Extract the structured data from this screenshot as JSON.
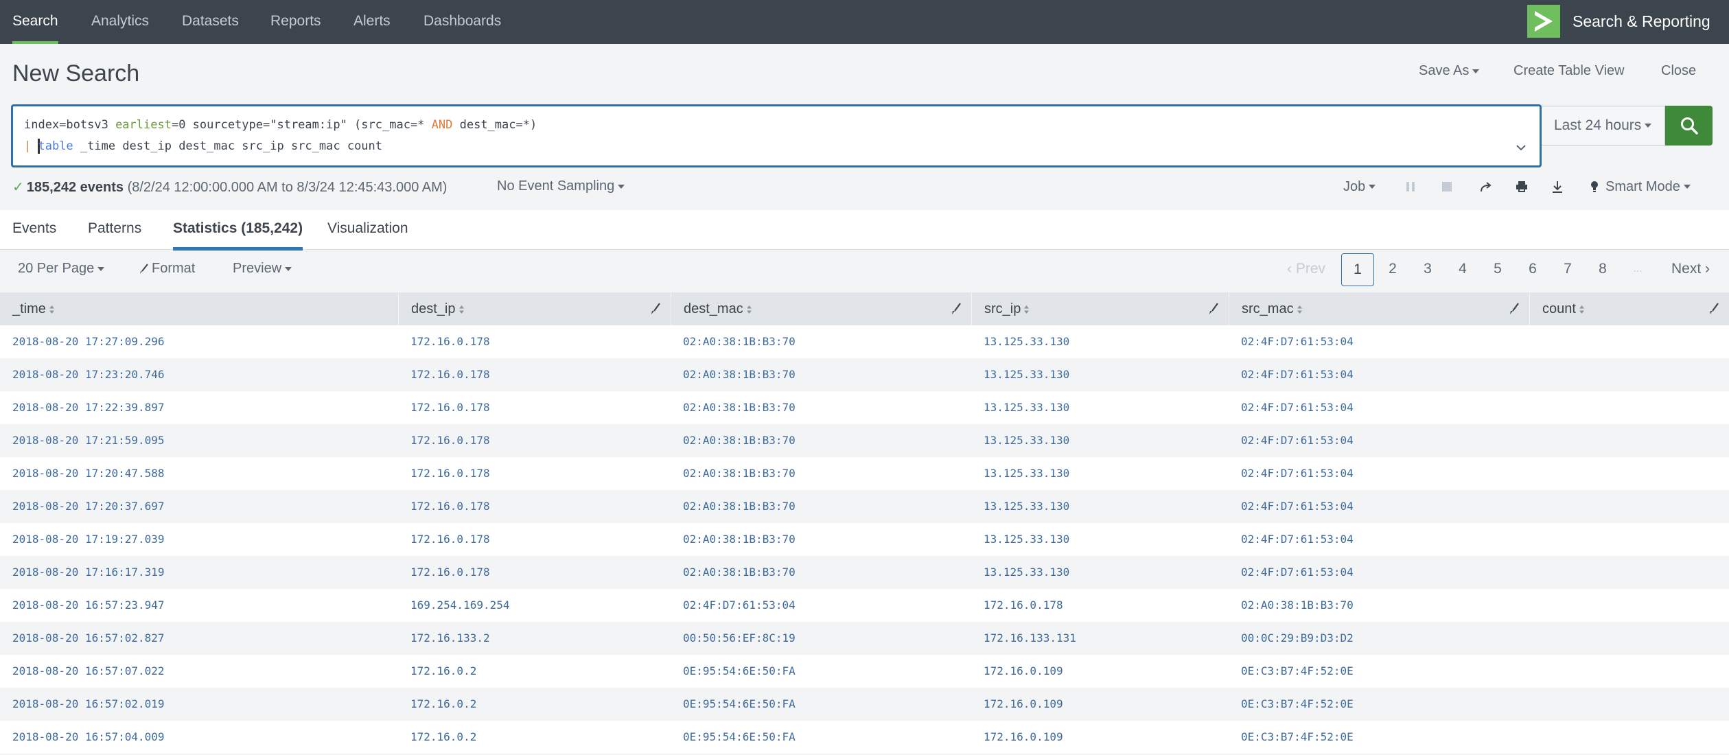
{
  "nav": {
    "items": [
      {
        "label": "Search",
        "active": true
      },
      {
        "label": "Analytics"
      },
      {
        "label": "Datasets"
      },
      {
        "label": "Reports"
      },
      {
        "label": "Alerts"
      },
      {
        "label": "Dashboards"
      }
    ],
    "app_name": "Search & Reporting",
    "logo_icon": "splunk-chevron-icon"
  },
  "header": {
    "title": "New Search",
    "save_as": "Save As",
    "create_table_view": "Create Table View",
    "close": "Close"
  },
  "search": {
    "line1": {
      "p1": "index=botsv3 ",
      "p2": "earliest",
      "p3": "=0 sourcetype=\"stream:ip\" (src_mac=* ",
      "p4": "AND",
      "p5": " dest_mac=*)"
    },
    "line2": {
      "pipe": "| ",
      "command": "table",
      "rest": " _time dest_ip dest_mac src_ip src_mac count"
    },
    "time_range": "Last 24 hours",
    "search_icon": "magnifier-icon"
  },
  "status": {
    "count": "185,242 events",
    "range": "(8/2/24 12:00:00.000 AM to 8/3/24 12:45:43.000 AM)",
    "sampling": "No Event Sampling",
    "job": "Job",
    "mode": "Smart Mode"
  },
  "colors": {
    "nav_bg": "#3c444d",
    "accent_green": "#6fbf5f",
    "search_button": "#3e8a3a",
    "active_tab": "#2f78b4",
    "link_blue": "#3e6a9e"
  },
  "tabs": [
    {
      "label": "Events"
    },
    {
      "label": "Patterns"
    },
    {
      "label": "Statistics (185,242)",
      "active": true
    },
    {
      "label": "Visualization"
    }
  ],
  "toolbar": {
    "per_page": "20 Per Page",
    "format": "Format",
    "preview": "Preview"
  },
  "pager": {
    "prev": "Prev",
    "pages": [
      "1",
      "2",
      "3",
      "4",
      "5",
      "6",
      "7",
      "8"
    ],
    "current": "1",
    "ellipsis": "...",
    "next": "Next"
  },
  "table": {
    "columns": [
      "_time",
      "dest_ip",
      "dest_mac",
      "src_ip",
      "src_mac",
      "count"
    ],
    "rows": [
      [
        "2018-08-20 17:27:09.296",
        "172.16.0.178",
        "02:A0:38:1B:B3:70",
        "13.125.33.130",
        "02:4F:D7:61:53:04",
        ""
      ],
      [
        "2018-08-20 17:23:20.746",
        "172.16.0.178",
        "02:A0:38:1B:B3:70",
        "13.125.33.130",
        "02:4F:D7:61:53:04",
        ""
      ],
      [
        "2018-08-20 17:22:39.897",
        "172.16.0.178",
        "02:A0:38:1B:B3:70",
        "13.125.33.130",
        "02:4F:D7:61:53:04",
        ""
      ],
      [
        "2018-08-20 17:21:59.095",
        "172.16.0.178",
        "02:A0:38:1B:B3:70",
        "13.125.33.130",
        "02:4F:D7:61:53:04",
        ""
      ],
      [
        "2018-08-20 17:20:47.588",
        "172.16.0.178",
        "02:A0:38:1B:B3:70",
        "13.125.33.130",
        "02:4F:D7:61:53:04",
        ""
      ],
      [
        "2018-08-20 17:20:37.697",
        "172.16.0.178",
        "02:A0:38:1B:B3:70",
        "13.125.33.130",
        "02:4F:D7:61:53:04",
        ""
      ],
      [
        "2018-08-20 17:19:27.039",
        "172.16.0.178",
        "02:A0:38:1B:B3:70",
        "13.125.33.130",
        "02:4F:D7:61:53:04",
        ""
      ],
      [
        "2018-08-20 17:16:17.319",
        "172.16.0.178",
        "02:A0:38:1B:B3:70",
        "13.125.33.130",
        "02:4F:D7:61:53:04",
        ""
      ],
      [
        "2018-08-20 16:57:23.947",
        "169.254.169.254",
        "02:4F:D7:61:53:04",
        "172.16.0.178",
        "02:A0:38:1B:B3:70",
        ""
      ],
      [
        "2018-08-20 16:57:02.827",
        "172.16.133.2",
        "00:50:56:EF:8C:19",
        "172.16.133.131",
        "00:0C:29:B9:D3:D2",
        ""
      ],
      [
        "2018-08-20 16:57:07.022",
        "172.16.0.2",
        "0E:95:54:6E:50:FA",
        "172.16.0.109",
        "0E:C3:B7:4F:52:0E",
        ""
      ],
      [
        "2018-08-20 16:57:02.019",
        "172.16.0.2",
        "0E:95:54:6E:50:FA",
        "172.16.0.109",
        "0E:C3:B7:4F:52:0E",
        ""
      ],
      [
        "2018-08-20 16:57:04.009",
        "172.16.0.2",
        "0E:95:54:6E:50:FA",
        "172.16.0.109",
        "0E:C3:B7:4F:52:0E",
        ""
      ]
    ]
  }
}
